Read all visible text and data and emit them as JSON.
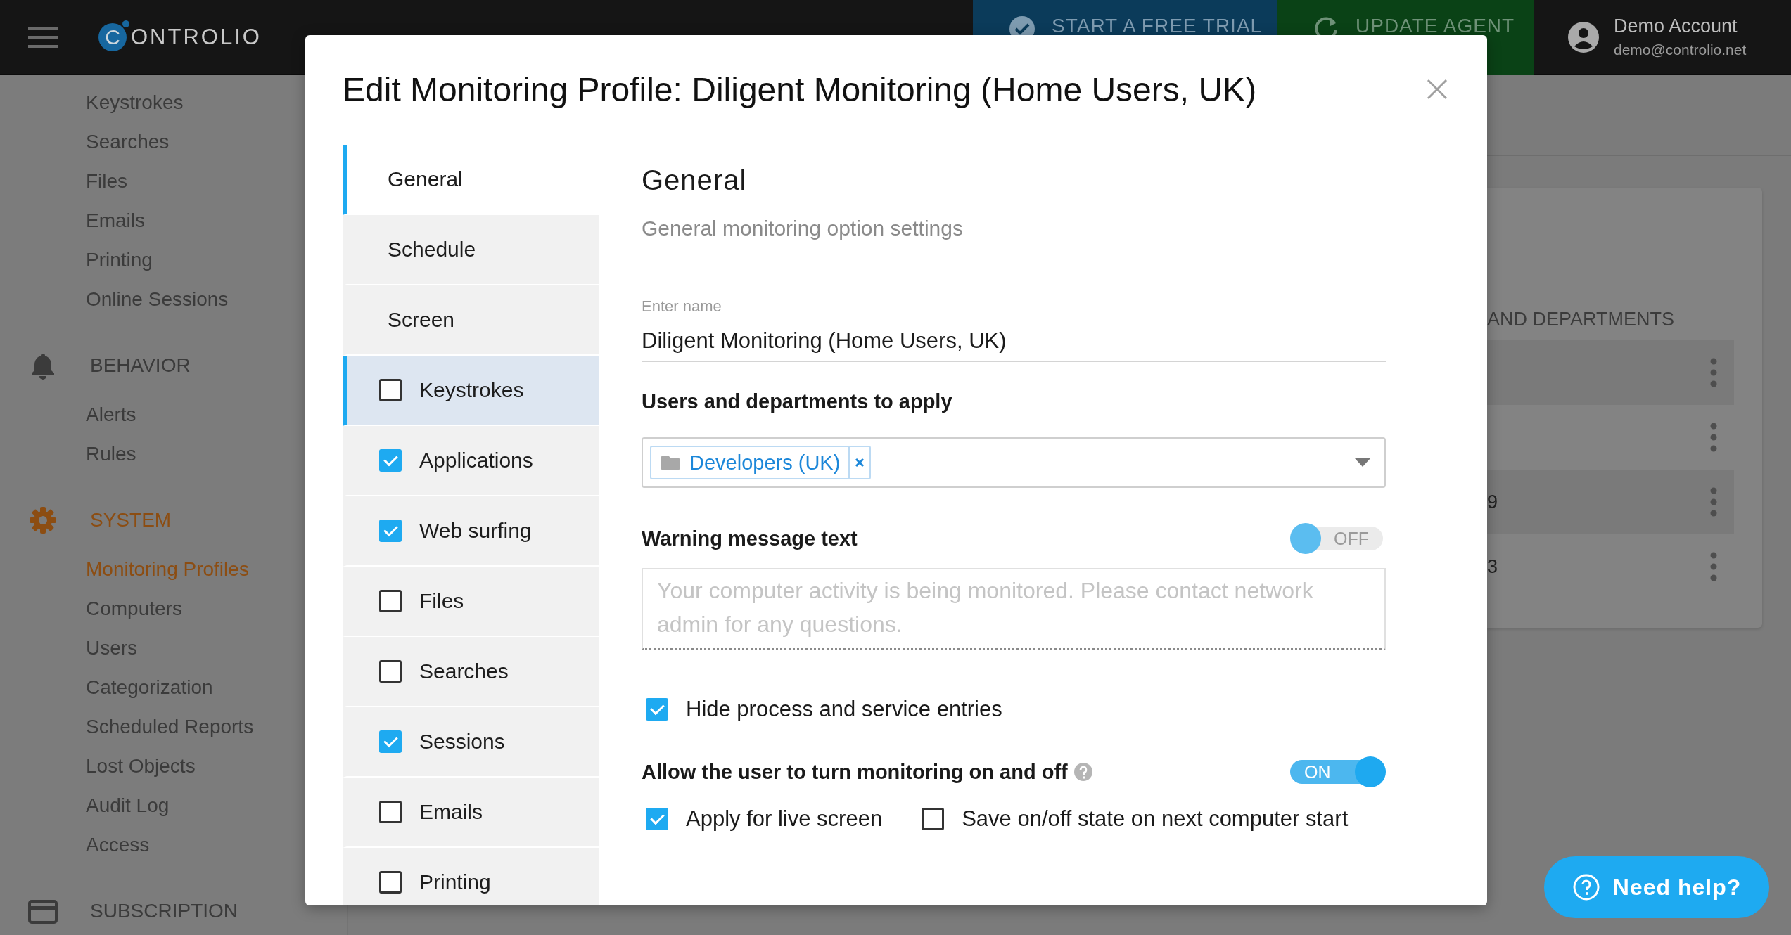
{
  "top_bar": {
    "brand_mark": "C",
    "brand_name": "ONTROLIO",
    "trial_button": "START A FREE TRIAL",
    "update_button": "UPDATE AGENT",
    "account": {
      "name": "Demo Account",
      "email": "demo@controlio.net"
    }
  },
  "sidebar": {
    "groups": [
      {
        "kind": "plain",
        "items": [
          {
            "label": "Keystrokes",
            "selected": false
          },
          {
            "label": "Searches",
            "selected": false
          },
          {
            "label": "Files",
            "selected": false
          },
          {
            "label": "Emails",
            "selected": false
          },
          {
            "label": "Printing",
            "selected": false
          },
          {
            "label": "Online Sessions",
            "selected": false
          }
        ]
      },
      {
        "kind": "section",
        "title": "BEHAVIOR",
        "active": false,
        "items": [
          {
            "label": "Alerts",
            "selected": false
          },
          {
            "label": "Rules",
            "selected": false
          }
        ]
      },
      {
        "kind": "section",
        "title": "SYSTEM",
        "active": true,
        "items": [
          {
            "label": "Monitoring Profiles",
            "selected": true
          },
          {
            "label": "Computers",
            "selected": false
          },
          {
            "label": "Users",
            "selected": false
          },
          {
            "label": "Categorization",
            "selected": false
          },
          {
            "label": "Scheduled Reports",
            "selected": false
          },
          {
            "label": "Lost Objects",
            "selected": false
          },
          {
            "label": "Audit Log",
            "selected": false
          },
          {
            "label": "Access",
            "selected": false
          }
        ]
      },
      {
        "kind": "section",
        "title": "SUBSCRIPTION",
        "active": false
      }
    ]
  },
  "background_card": {
    "column_header": "AND DEPARTMENTS",
    "rows": [
      {
        "kind": "blank"
      },
      {
        "kind": "blank"
      },
      {
        "kind": "text",
        "value": "9"
      },
      {
        "kind": "text",
        "value": "3"
      }
    ]
  },
  "modal": {
    "title": "Edit Monitoring Profile: Diligent Monitoring (Home Users, UK)",
    "tabs": [
      {
        "label": "General",
        "kind": "plain",
        "selected": true,
        "highlighted": false
      },
      {
        "label": "Schedule",
        "kind": "plain",
        "selected": false,
        "highlighted": false
      },
      {
        "label": "Screen",
        "kind": "plain",
        "selected": false,
        "highlighted": false
      },
      {
        "label": "Keystrokes",
        "kind": "check",
        "checked": false,
        "selected": false,
        "highlighted": true
      },
      {
        "label": "Applications",
        "kind": "check",
        "checked": true,
        "selected": false,
        "highlighted": false
      },
      {
        "label": "Web surfing",
        "kind": "check",
        "checked": true,
        "selected": false,
        "highlighted": false
      },
      {
        "label": "Files",
        "kind": "check",
        "checked": false,
        "selected": false,
        "highlighted": false
      },
      {
        "label": "Searches",
        "kind": "check",
        "checked": false,
        "selected": false,
        "highlighted": false
      },
      {
        "label": "Sessions",
        "kind": "check",
        "checked": true,
        "selected": false,
        "highlighted": false
      },
      {
        "label": "Emails",
        "kind": "check",
        "checked": false,
        "selected": false,
        "highlighted": false
      },
      {
        "label": "Printing",
        "kind": "check",
        "checked": false,
        "selected": false,
        "highlighted": false
      }
    ],
    "heading": "General",
    "subtitle": "General monitoring option settings",
    "name_field": {
      "label": "Enter name",
      "value": "Diligent Monitoring (Home Users, UK)"
    },
    "users_label": "Users and departments to apply",
    "users_tags": [
      {
        "label": "Developers (UK)"
      }
    ],
    "warning": {
      "label": "Warning message text",
      "toggle": {
        "on": false,
        "text": "OFF"
      },
      "placeholder": "Your computer activity is being monitored. Please contact network admin for any questions."
    },
    "hide_process": {
      "label": "Hide process and service entries",
      "checked": true
    },
    "allow": {
      "label": "Allow the user to turn monitoring on and off",
      "toggle": {
        "on": true,
        "text": "ON"
      }
    },
    "options": [
      {
        "label": "Apply for live screen",
        "checked": true
      },
      {
        "label": "Save on/off state on next computer start",
        "checked": false
      }
    ]
  },
  "help_button": "Need help?"
}
